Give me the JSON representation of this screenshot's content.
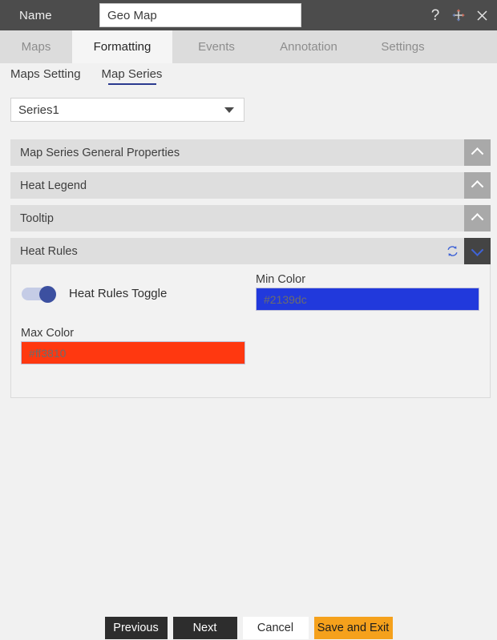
{
  "titlebar": {
    "name_label": "Name",
    "name_value": "Geo Map",
    "help_icon": "question-mark-icon",
    "move_icon": "move-arrows-icon",
    "close_icon": "close-icon"
  },
  "tabs": [
    {
      "label": "Maps",
      "active": false
    },
    {
      "label": "Formatting",
      "active": true
    },
    {
      "label": "Events",
      "active": false
    },
    {
      "label": "Annotation",
      "active": false
    },
    {
      "label": "Settings",
      "active": false
    }
  ],
  "subnav": [
    {
      "label": "Maps Setting",
      "selected": false
    },
    {
      "label": "Map Series",
      "selected": true
    }
  ],
  "series_select": {
    "value": "Series1",
    "caret_icon": "chevron-down-icon"
  },
  "accordion": [
    {
      "title": "Map Series General Properties",
      "expanded": false,
      "chevron_icon": "chevron-up-icon"
    },
    {
      "title": "Heat Legend",
      "expanded": false,
      "chevron_icon": "chevron-up-icon"
    },
    {
      "title": "Tooltip",
      "expanded": false,
      "chevron_icon": "chevron-up-icon"
    },
    {
      "title": "Heat Rules",
      "expanded": true,
      "chevron_icon": "chevron-down-icon",
      "refresh_icon": "refresh-sync-icon"
    }
  ],
  "heat_rules": {
    "toggle_label": "Heat Rules Toggle",
    "toggle_on": true,
    "min_color_label": "Min Color",
    "min_color_value": "#2139dc",
    "max_color_label": "Max Color",
    "max_color_value": "#ff3810"
  },
  "footer": {
    "previous": "Previous",
    "next": "Next",
    "cancel": "Cancel",
    "save_and_exit": "Save and Exit"
  },
  "colors": {
    "titlebar_bg": "#4c4c4c",
    "tabbar_bg": "#dcdcdc",
    "active_tab_bg": "#f5f5f5",
    "accordion_header_bg": "#dedede",
    "accordion_toggle_bg": "#a9a9a9",
    "accordion_toggle_expanded_bg": "#444444",
    "accent_orange": "#f5a11c",
    "underline_blue": "#2b3a8f",
    "toggle_knob": "#3c50a0"
  }
}
